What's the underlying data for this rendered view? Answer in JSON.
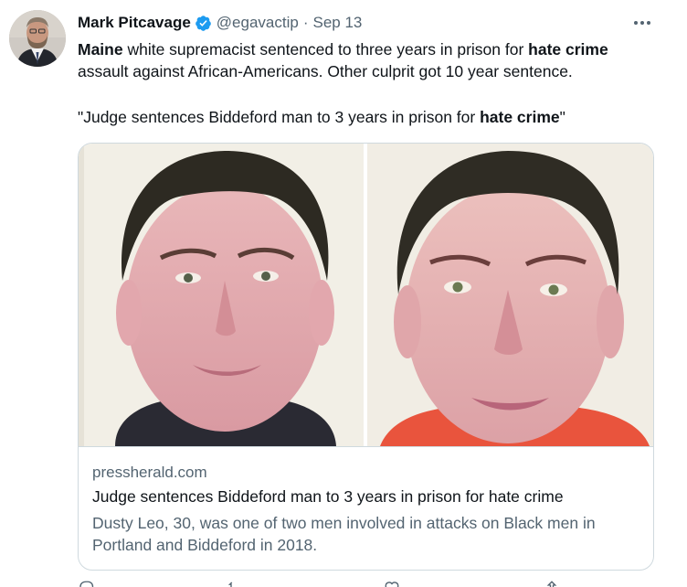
{
  "author": {
    "name": "Mark Pitcavage",
    "handle": "@egavactip",
    "separator": "·",
    "date": "Sep 13",
    "verified_color": "#1d9bf0"
  },
  "tweet": {
    "line1_bold": "Maine",
    "line1_rest": " white supremacist sentenced to three years in prison for ",
    "line1_bold2": "hate crime",
    "line2": "assault against African-Americans. Other culprit got 10 year sentence.",
    "quote_prefix": "\"Judge sentences Biddeford man to 3 years in prison for ",
    "quote_bold": "hate crime",
    "quote_suffix": "\""
  },
  "card": {
    "domain": "pressherald.com",
    "title": "Judge sentences Biddeford man to 3 years in prison for hate crime",
    "description": "Dusty Leo, 30, was one of two men involved in attacks on Black men in Portland and Biddeford in 2018."
  },
  "icons": {
    "more": "more-horizontal-icon",
    "verified": "verified-badge-icon",
    "reply": "reply-icon",
    "retweet": "retweet-icon",
    "like": "like-icon",
    "share": "share-icon"
  }
}
